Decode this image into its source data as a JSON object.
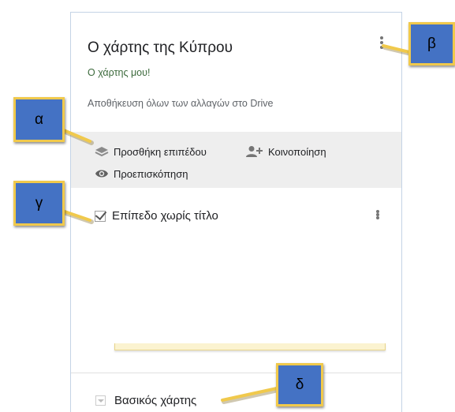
{
  "map": {
    "title": "Ο χάρτης της Κύπρου",
    "description": "Ο χάρτης μου!",
    "save_status": "Αποθήκευση όλων των αλλαγών στο Drive"
  },
  "actions": {
    "add_layer": "Προσθήκη επιπέδου",
    "share": "Κοινοποίηση",
    "preview": "Προεπισκόπηση"
  },
  "layer": {
    "name": "Επίπεδο χωρίς τίτλο",
    "checked": true
  },
  "basemap": {
    "label": "Βασικός χάρτης"
  },
  "callouts": {
    "alpha": "α",
    "beta": "β",
    "gamma": "γ",
    "delta": "δ"
  },
  "icons": {
    "layers": "layers-icon",
    "share": "person-add-icon",
    "preview": "eye-icon",
    "menu": "more-vert-icon",
    "dropdown": "dropdown-icon"
  },
  "colors": {
    "callout_fill": "#4472c4",
    "callout_border": "#f0c94c",
    "actions_bg": "#eeeeee",
    "description_text": "#3c6a3c"
  }
}
